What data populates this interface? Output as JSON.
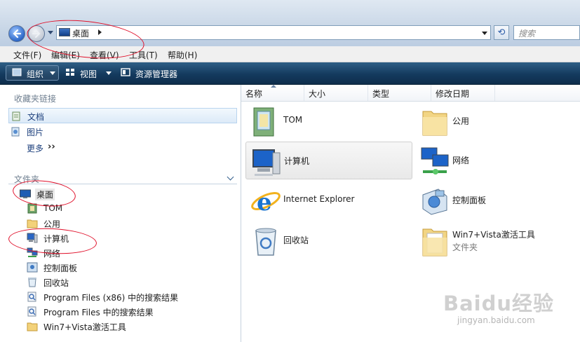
{
  "address_bar": {
    "location": "桌面",
    "search_placeholder": "搜索"
  },
  "menu": [
    "文件(F)",
    "编辑(E)",
    "查看(V)",
    "工具(T)",
    "帮助(H)"
  ],
  "toolbar": {
    "organize": "组织",
    "views": "视图",
    "explorer": "资源管理器"
  },
  "nav": {
    "favorites_title": "收藏夹链接",
    "favorites": [
      {
        "label": "文档",
        "icon": "documents-icon"
      },
      {
        "label": "图片",
        "icon": "pictures-icon"
      }
    ],
    "more": "更多",
    "folders_title": "文件夹",
    "tree": [
      {
        "label": "桌面",
        "icon": "desktop-icon"
      },
      {
        "label": "TOM",
        "icon": "user-folder-icon"
      },
      {
        "label": "公用",
        "icon": "folder-icon"
      },
      {
        "label": "计算机",
        "icon": "computer-icon"
      },
      {
        "label": "网络",
        "icon": "network-icon"
      },
      {
        "label": "控制面板",
        "icon": "control-panel-icon"
      },
      {
        "label": "回收站",
        "icon": "recycle-bin-icon"
      },
      {
        "label": "Program Files (x86) 中的搜索结果",
        "icon": "search-results-icon"
      },
      {
        "label": "Program Files 中的搜索结果",
        "icon": "search-results-icon"
      },
      {
        "label": "Win7+Vista激活工具",
        "icon": "folder-icon"
      }
    ]
  },
  "columns": [
    "名称",
    "大小",
    "类型",
    "修改日期"
  ],
  "items": [
    {
      "name": "TOM",
      "sub": "",
      "icon": "user-folder-icon"
    },
    {
      "name": "公用",
      "sub": "",
      "icon": "folder-icon"
    },
    {
      "name": "计算机",
      "sub": "",
      "icon": "computer-icon"
    },
    {
      "name": "网络",
      "sub": "",
      "icon": "network-icon"
    },
    {
      "name": "Internet Explorer",
      "sub": "",
      "icon": "internet-explorer-icon"
    },
    {
      "name": "控制面板",
      "sub": "",
      "icon": "control-panel-icon"
    },
    {
      "name": "回收站",
      "sub": "",
      "icon": "recycle-bin-icon"
    },
    {
      "name": "Win7+Vista激活工具",
      "sub": "文件夹",
      "icon": "folder-icon"
    }
  ],
  "watermark": {
    "brand": "Baidu经验",
    "url": "jingyan.baidu.com"
  },
  "colors": {
    "toolbar": "#143a5e",
    "annotation": "#e0102a",
    "link": "#1c3f7c"
  }
}
